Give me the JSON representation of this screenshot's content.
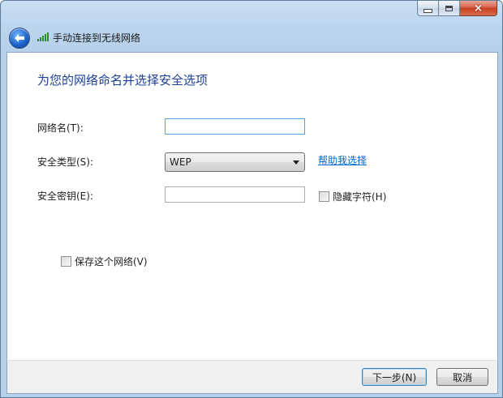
{
  "window": {
    "title": "手动连接到无线网络",
    "caption": {
      "minimize": "minimize",
      "maximize": "maximize",
      "close": "×"
    }
  },
  "icons": {
    "back": "back-arrow-icon",
    "wifi": "wireless-signal-icon"
  },
  "main": {
    "heading": "为您的网络命名并选择安全选项",
    "network_name": {
      "label": "网络名(T):",
      "value": "",
      "placeholder": ""
    },
    "security_type": {
      "label": "安全类型(S):",
      "selected": "WEP",
      "help_link": "帮助我选择"
    },
    "security_key": {
      "label": "安全密钥(E):",
      "value": "",
      "hide_chars_label": "隐藏字符(H)",
      "hide_chars_checked": false
    },
    "save_network": {
      "label": "保存这个网络(V)",
      "checked": false
    }
  },
  "footer": {
    "next_label": "下一步(N)",
    "cancel_label": "取消"
  },
  "colors": {
    "heading": "#1c3f95",
    "link": "#0066cc",
    "frame": "#b6d0ea",
    "close_button": "#c8401f"
  }
}
